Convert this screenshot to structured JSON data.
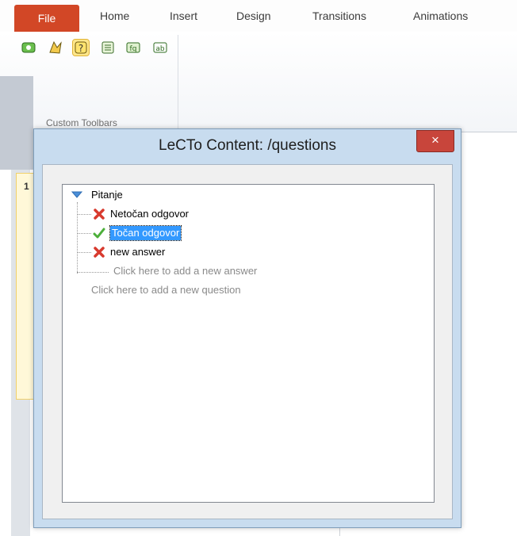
{
  "ribbon": {
    "tabs": [
      "File",
      "Home",
      "Insert",
      "Design",
      "Transitions",
      "Animations"
    ],
    "group_label": "Custom Toolbars",
    "buttons": [
      "toolbar-icon-1",
      "toolbar-icon-2",
      "help-icon",
      "list-icon",
      "toolbar-icon-5",
      "toolbar-icon-6"
    ]
  },
  "slides": {
    "first_number": "1"
  },
  "dialog": {
    "title": "LeCTo Content: /questions",
    "close_label": "×",
    "tree": {
      "question": "Pitanje",
      "answers": [
        {
          "label": "Netočan odgovor",
          "correct": false
        },
        {
          "label": "Točan odgovor",
          "correct": true,
          "selected": true
        },
        {
          "label": "new answer",
          "correct": false
        }
      ],
      "add_answer_hint": "Click here to add a new answer",
      "add_question_hint": "Click here to add a new question"
    }
  },
  "colors": {
    "file_tab": "#d24726",
    "close_button": "#c8453b",
    "selection": "#3399ff",
    "dialog_frame": "#c8dcef"
  }
}
